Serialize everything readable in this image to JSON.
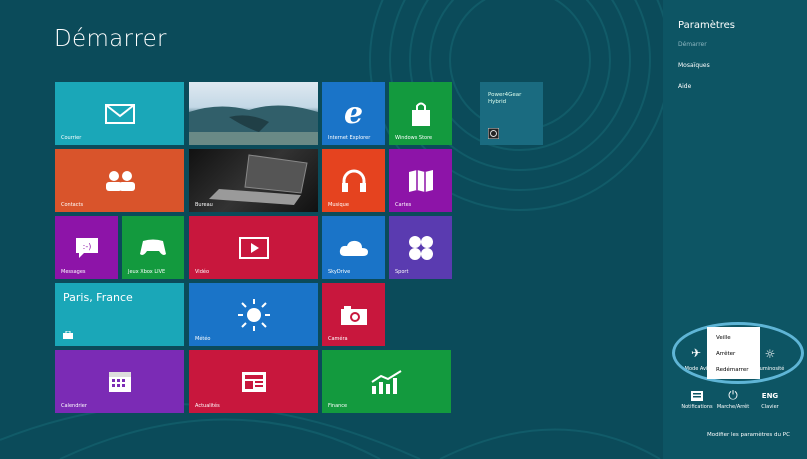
{
  "start": {
    "title": "Démarrer"
  },
  "tiles": {
    "mail": "Courrier",
    "ie": "Internet Explorer",
    "store": "Windows Store",
    "contacts": "Contacts",
    "desktop": "Bureau",
    "music": "Musique",
    "maps": "Cartes",
    "messaging": "Messages",
    "xbox": "Jeux Xbox LIVE",
    "video": "Vidéo",
    "skydrive": "SkyDrive",
    "sport": "Sport",
    "weather_city": "Paris, France",
    "weather": "Météo",
    "camera": "Caméra",
    "calendar": "Calendrier",
    "news": "Actualités",
    "finance": "Finance",
    "power4gear": "Power4Gear Hybrid"
  },
  "charms": {
    "title": "Paramètres",
    "items": [
      "Démarrer",
      "Mosaïques",
      "Aide"
    ],
    "quick": {
      "airplane": "Mode Avi",
      "brightness": "uminosité",
      "notifications": "Notifications",
      "power": "Marche/Arrêt",
      "keyboard": "Clavier",
      "keyboard_lang": "ENG"
    },
    "modify_pc": "Modifier les paramètres du PC"
  },
  "power_menu": [
    "Veille",
    "Arrêter",
    "Redémarrer"
  ],
  "colors": {
    "background": "#0b4b5a",
    "teal": "#1aa7b8",
    "blue": "#1a74c8",
    "green": "#139a3e",
    "orange": "#d9542b",
    "red": "#c8173d",
    "purple": "#7b2bb5",
    "magenta": "#8d14a8",
    "violet": "#5a3bb0"
  }
}
